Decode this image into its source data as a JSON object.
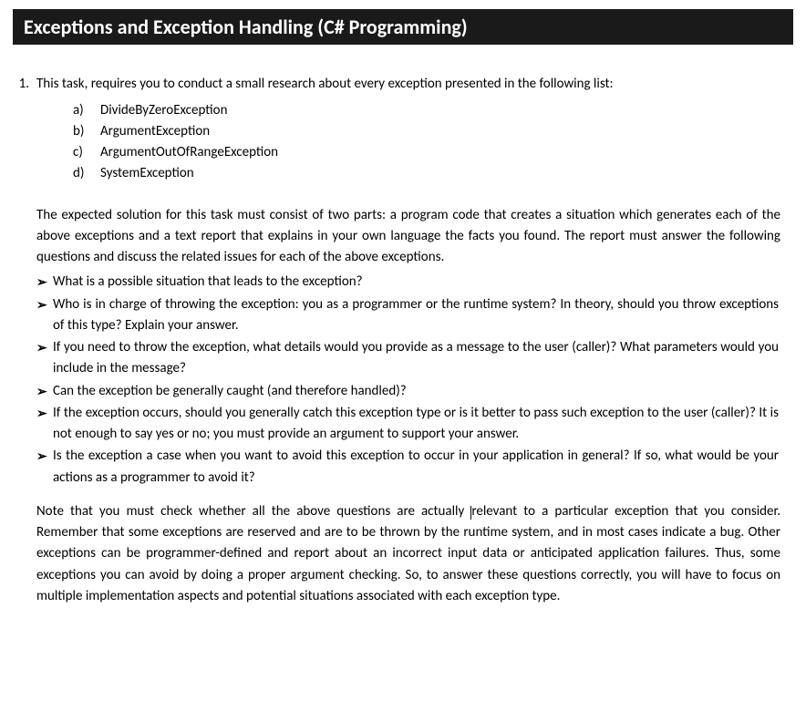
{
  "header": {
    "title": "Exceptions and Exception Handling (C# Programming)"
  },
  "task": {
    "number": "1.",
    "intro": "This task, requires you to conduct a small research about every exception presented in the following list:",
    "exceptions": [
      {
        "label": "a)",
        "name": "DivideByZeroException"
      },
      {
        "label": "b)",
        "name": "ArgumentException"
      },
      {
        "label": "c)",
        "name": "ArgumentOutOfRangeException"
      },
      {
        "label": "d)",
        "name": "SystemException"
      }
    ],
    "expected": "The expected solution for this task must consist of two parts: a program code that creates a situation which generates each of the above exceptions and a text report that explains in your own language the facts you found. The report must answer the following questions and discuss the related issues for each of the above exceptions.",
    "bullets": [
      "What is a possible situation that leads to the exception?",
      "Who is in charge of throwing the exception: you as a programmer or the runtime system? In theory, should you throw exceptions of this type? Explain your answer.",
      "If you need to throw the exception, what details would you provide as a message to the user (caller)? What parameters would you include in the message?",
      "Can the exception be generally caught (and therefore handled)?",
      "If the exception occurs, should you generally catch this exception type or is it better to pass such exception to the user (caller)? It is not enough to say yes or no; you must provide an argument to support your answer.",
      "Is the exception a case when you want to avoid this exception to occur in your application in general? If so, what would be your actions as a programmer to avoid it?"
    ],
    "note_before_cursor": "Note that you must check whether all the above questions are actually ",
    "note_after_cursor": "relevant to a particular exception that you consider. Remember that some exceptions are reserved and are to be thrown by the runtime system, and in most cases indicate a bug. Other exceptions can be programmer-defined and report about an incorrect input data or anticipated application failures. Thus, some exceptions you can avoid by doing a proper argument checking. So, to answer these questions correctly, you will have to focus on multiple implementation aspects and potential situations associated with each exception type."
  },
  "bullet_glyph": "➢"
}
